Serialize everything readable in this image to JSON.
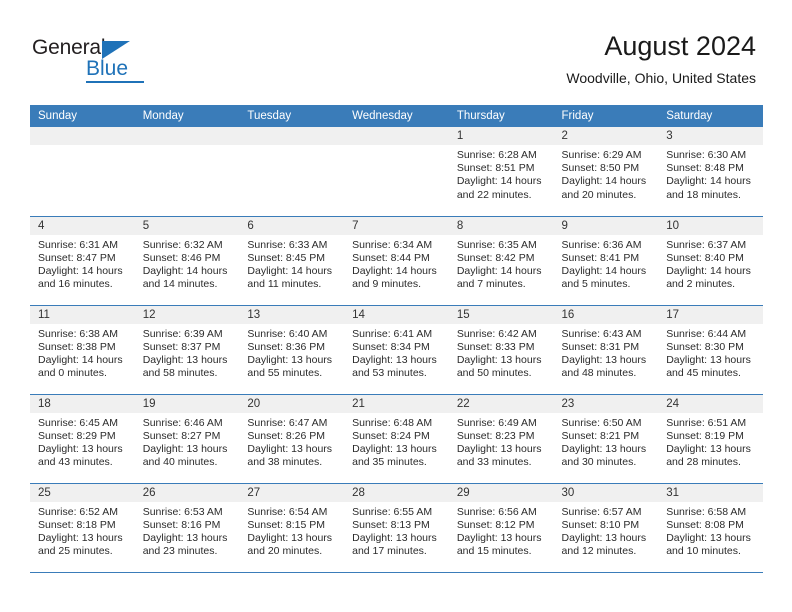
{
  "logo": {
    "word_top": "General",
    "word_bottom": "Blue",
    "brand_color": "#1f72b8",
    "triangle_icon": "triangle-icon"
  },
  "header": {
    "title": "August 2024",
    "subtitle": "Woodville, Ohio, United States"
  },
  "calendar": {
    "header_bg": "#3a7cb9",
    "daynum_bg": "#f0f0f0",
    "weekdays": [
      "Sunday",
      "Monday",
      "Tuesday",
      "Wednesday",
      "Thursday",
      "Friday",
      "Saturday"
    ],
    "weeks": [
      [
        {
          "day": "",
          "empty": true
        },
        {
          "day": "",
          "empty": true
        },
        {
          "day": "",
          "empty": true
        },
        {
          "day": "",
          "empty": true
        },
        {
          "day": "1",
          "sunrise": "Sunrise: 6:28 AM",
          "sunset": "Sunset: 8:51 PM",
          "daylight1": "Daylight: 14 hours",
          "daylight2": "and 22 minutes."
        },
        {
          "day": "2",
          "sunrise": "Sunrise: 6:29 AM",
          "sunset": "Sunset: 8:50 PM",
          "daylight1": "Daylight: 14 hours",
          "daylight2": "and 20 minutes."
        },
        {
          "day": "3",
          "sunrise": "Sunrise: 6:30 AM",
          "sunset": "Sunset: 8:48 PM",
          "daylight1": "Daylight: 14 hours",
          "daylight2": "and 18 minutes."
        }
      ],
      [
        {
          "day": "4",
          "sunrise": "Sunrise: 6:31 AM",
          "sunset": "Sunset: 8:47 PM",
          "daylight1": "Daylight: 14 hours",
          "daylight2": "and 16 minutes."
        },
        {
          "day": "5",
          "sunrise": "Sunrise: 6:32 AM",
          "sunset": "Sunset: 8:46 PM",
          "daylight1": "Daylight: 14 hours",
          "daylight2": "and 14 minutes."
        },
        {
          "day": "6",
          "sunrise": "Sunrise: 6:33 AM",
          "sunset": "Sunset: 8:45 PM",
          "daylight1": "Daylight: 14 hours",
          "daylight2": "and 11 minutes."
        },
        {
          "day": "7",
          "sunrise": "Sunrise: 6:34 AM",
          "sunset": "Sunset: 8:44 PM",
          "daylight1": "Daylight: 14 hours",
          "daylight2": "and 9 minutes."
        },
        {
          "day": "8",
          "sunrise": "Sunrise: 6:35 AM",
          "sunset": "Sunset: 8:42 PM",
          "daylight1": "Daylight: 14 hours",
          "daylight2": "and 7 minutes."
        },
        {
          "day": "9",
          "sunrise": "Sunrise: 6:36 AM",
          "sunset": "Sunset: 8:41 PM",
          "daylight1": "Daylight: 14 hours",
          "daylight2": "and 5 minutes."
        },
        {
          "day": "10",
          "sunrise": "Sunrise: 6:37 AM",
          "sunset": "Sunset: 8:40 PM",
          "daylight1": "Daylight: 14 hours",
          "daylight2": "and 2 minutes."
        }
      ],
      [
        {
          "day": "11",
          "sunrise": "Sunrise: 6:38 AM",
          "sunset": "Sunset: 8:38 PM",
          "daylight1": "Daylight: 14 hours",
          "daylight2": "and 0 minutes."
        },
        {
          "day": "12",
          "sunrise": "Sunrise: 6:39 AM",
          "sunset": "Sunset: 8:37 PM",
          "daylight1": "Daylight: 13 hours",
          "daylight2": "and 58 minutes."
        },
        {
          "day": "13",
          "sunrise": "Sunrise: 6:40 AM",
          "sunset": "Sunset: 8:36 PM",
          "daylight1": "Daylight: 13 hours",
          "daylight2": "and 55 minutes."
        },
        {
          "day": "14",
          "sunrise": "Sunrise: 6:41 AM",
          "sunset": "Sunset: 8:34 PM",
          "daylight1": "Daylight: 13 hours",
          "daylight2": "and 53 minutes."
        },
        {
          "day": "15",
          "sunrise": "Sunrise: 6:42 AM",
          "sunset": "Sunset: 8:33 PM",
          "daylight1": "Daylight: 13 hours",
          "daylight2": "and 50 minutes."
        },
        {
          "day": "16",
          "sunrise": "Sunrise: 6:43 AM",
          "sunset": "Sunset: 8:31 PM",
          "daylight1": "Daylight: 13 hours",
          "daylight2": "and 48 minutes."
        },
        {
          "day": "17",
          "sunrise": "Sunrise: 6:44 AM",
          "sunset": "Sunset: 8:30 PM",
          "daylight1": "Daylight: 13 hours",
          "daylight2": "and 45 minutes."
        }
      ],
      [
        {
          "day": "18",
          "sunrise": "Sunrise: 6:45 AM",
          "sunset": "Sunset: 8:29 PM",
          "daylight1": "Daylight: 13 hours",
          "daylight2": "and 43 minutes."
        },
        {
          "day": "19",
          "sunrise": "Sunrise: 6:46 AM",
          "sunset": "Sunset: 8:27 PM",
          "daylight1": "Daylight: 13 hours",
          "daylight2": "and 40 minutes."
        },
        {
          "day": "20",
          "sunrise": "Sunrise: 6:47 AM",
          "sunset": "Sunset: 8:26 PM",
          "daylight1": "Daylight: 13 hours",
          "daylight2": "and 38 minutes."
        },
        {
          "day": "21",
          "sunrise": "Sunrise: 6:48 AM",
          "sunset": "Sunset: 8:24 PM",
          "daylight1": "Daylight: 13 hours",
          "daylight2": "and 35 minutes."
        },
        {
          "day": "22",
          "sunrise": "Sunrise: 6:49 AM",
          "sunset": "Sunset: 8:23 PM",
          "daylight1": "Daylight: 13 hours",
          "daylight2": "and 33 minutes."
        },
        {
          "day": "23",
          "sunrise": "Sunrise: 6:50 AM",
          "sunset": "Sunset: 8:21 PM",
          "daylight1": "Daylight: 13 hours",
          "daylight2": "and 30 minutes."
        },
        {
          "day": "24",
          "sunrise": "Sunrise: 6:51 AM",
          "sunset": "Sunset: 8:19 PM",
          "daylight1": "Daylight: 13 hours",
          "daylight2": "and 28 minutes."
        }
      ],
      [
        {
          "day": "25",
          "sunrise": "Sunrise: 6:52 AM",
          "sunset": "Sunset: 8:18 PM",
          "daylight1": "Daylight: 13 hours",
          "daylight2": "and 25 minutes."
        },
        {
          "day": "26",
          "sunrise": "Sunrise: 6:53 AM",
          "sunset": "Sunset: 8:16 PM",
          "daylight1": "Daylight: 13 hours",
          "daylight2": "and 23 minutes."
        },
        {
          "day": "27",
          "sunrise": "Sunrise: 6:54 AM",
          "sunset": "Sunset: 8:15 PM",
          "daylight1": "Daylight: 13 hours",
          "daylight2": "and 20 minutes."
        },
        {
          "day": "28",
          "sunrise": "Sunrise: 6:55 AM",
          "sunset": "Sunset: 8:13 PM",
          "daylight1": "Daylight: 13 hours",
          "daylight2": "and 17 minutes."
        },
        {
          "day": "29",
          "sunrise": "Sunrise: 6:56 AM",
          "sunset": "Sunset: 8:12 PM",
          "daylight1": "Daylight: 13 hours",
          "daylight2": "and 15 minutes."
        },
        {
          "day": "30",
          "sunrise": "Sunrise: 6:57 AM",
          "sunset": "Sunset: 8:10 PM",
          "daylight1": "Daylight: 13 hours",
          "daylight2": "and 12 minutes."
        },
        {
          "day": "31",
          "sunrise": "Sunrise: 6:58 AM",
          "sunset": "Sunset: 8:08 PM",
          "daylight1": "Daylight: 13 hours",
          "daylight2": "and 10 minutes."
        }
      ]
    ]
  }
}
